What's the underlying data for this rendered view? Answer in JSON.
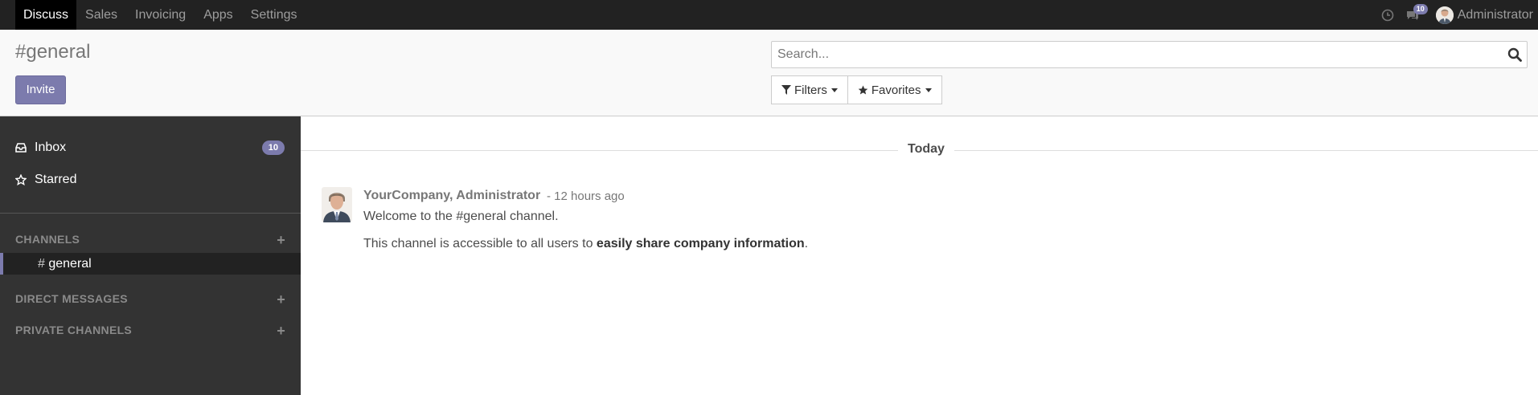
{
  "navbar": {
    "menu": [
      {
        "label": "Discuss",
        "active": true
      },
      {
        "label": "Sales"
      },
      {
        "label": "Invoicing"
      },
      {
        "label": "Apps"
      },
      {
        "label": "Settings"
      }
    ],
    "activity_icon": "clock-icon",
    "messages_icon": "chat-icon",
    "messages_count": "10",
    "user_name": "Administrator"
  },
  "control": {
    "title": "#general",
    "invite_label": "Invite",
    "search_placeholder": "Search...",
    "filters_label": "Filters",
    "favorites_label": "Favorites"
  },
  "sidebar": {
    "inbox_label": "Inbox",
    "inbox_count": "10",
    "starred_label": "Starred",
    "channels_header": "CHANNELS",
    "channel_hash": "#",
    "channel_name": "general",
    "direct_header": "DIRECT MESSAGES",
    "private_header": "PRIVATE CHANNELS",
    "add_glyph": "+"
  },
  "thread": {
    "day_label": "Today",
    "author": "YourCompany, Administrator",
    "time": "- 12 hours ago",
    "line1": "Welcome to the #general channel.",
    "line2_prefix": "This channel is accessible to all users to ",
    "line2_bold": "easily share company information",
    "line2_suffix": "."
  },
  "colors": {
    "navbar": "#222222",
    "accent": "#7c7bad",
    "sidebar": "#333333",
    "sidebar_active": "#222222"
  }
}
